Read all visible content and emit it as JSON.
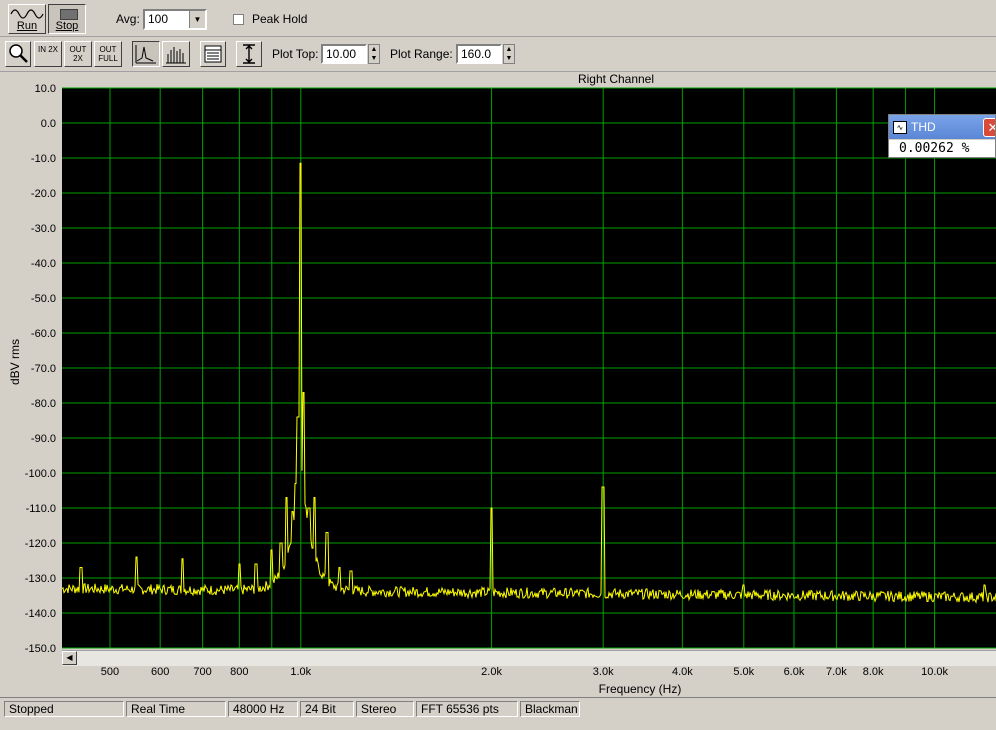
{
  "toolbar1": {
    "run_label": "Run",
    "stop_label": "Stop",
    "avg_label": "Avg:",
    "avg_value": "100",
    "peak_hold_label": "Peak Hold",
    "peak_hold_checked": false
  },
  "toolbar2": {
    "zoom_in_2x_label": "IN 2X",
    "zoom_out_2x_label": "OUT 2X",
    "zoom_out_full_label": "OUT FULL",
    "plot_top_label": "Plot Top:",
    "plot_top_value": "10.00",
    "plot_range_label": "Plot Range:",
    "plot_range_value": "160.0"
  },
  "thd": {
    "title": "THD",
    "value": "0.00262 %"
  },
  "colors": {
    "plot_background": "#000000",
    "grid": "#00a000",
    "trace": "#ffff00"
  },
  "chart_data": {
    "type": "line",
    "title": "Right Channel",
    "xlabel": "Frequency (Hz)",
    "ylabel": "dBV rms",
    "x_scale": "log",
    "xlim": [
      420,
      12500
    ],
    "ylim": [
      -150,
      10
    ],
    "y_ticks": [
      "10.0",
      "0.0",
      "-10.0",
      "-20.0",
      "-30.0",
      "-40.0",
      "-50.0",
      "-60.0",
      "-70.0",
      "-80.0",
      "-90.0",
      "-100.0",
      "-110.0",
      "-120.0",
      "-130.0",
      "-140.0",
      "-150.0"
    ],
    "x_tick_labels": [
      {
        "f": 500,
        "label": "500"
      },
      {
        "f": 600,
        "label": "600"
      },
      {
        "f": 700,
        "label": "700"
      },
      {
        "f": 800,
        "label": "800"
      },
      {
        "f": 1000,
        "label": "1.0k"
      },
      {
        "f": 2000,
        "label": "2.0k"
      },
      {
        "f": 3000,
        "label": "3.0k"
      },
      {
        "f": 4000,
        "label": "4.0k"
      },
      {
        "f": 5000,
        "label": "5.0k"
      },
      {
        "f": 6000,
        "label": "6.0k"
      },
      {
        "f": 7000,
        "label": "7.0k"
      },
      {
        "f": 8000,
        "label": "8.0k"
      },
      {
        "f": 10000,
        "label": "10.0k"
      }
    ],
    "grid": true,
    "noise_floor_db": -134.5,
    "series": [
      {
        "points": [
          {
            "f": 450,
            "db": -127
          },
          {
            "f": 550,
            "db": -124
          },
          {
            "f": 650,
            "db": -124.5
          },
          {
            "f": 800,
            "db": -126
          },
          {
            "f": 850,
            "db": -126
          },
          {
            "f": 900,
            "db": -122
          },
          {
            "f": 930,
            "db": -120
          },
          {
            "f": 950,
            "db": -107
          },
          {
            "f": 970,
            "db": -111
          },
          {
            "f": 980,
            "db": -103
          },
          {
            "f": 990,
            "db": -84
          },
          {
            "f": 1000,
            "db": -11.5
          },
          {
            "f": 1010,
            "db": -77
          },
          {
            "f": 1030,
            "db": -110
          },
          {
            "f": 1050,
            "db": -107
          },
          {
            "f": 1100,
            "db": -117
          },
          {
            "f": 1150,
            "db": -127
          },
          {
            "f": 1200,
            "db": -128
          },
          {
            "f": 2000,
            "db": -110
          },
          {
            "f": 3000,
            "db": -104
          },
          {
            "f": 5000,
            "db": -132
          },
          {
            "f": 12000,
            "db": -132
          }
        ]
      }
    ]
  },
  "status": {
    "state": "Stopped",
    "mode": "Real Time",
    "sample_rate": "48000 Hz",
    "bit_depth": "24 Bit",
    "channels": "Stereo",
    "fft_size": "FFT 65536 pts",
    "window": "Blackman"
  }
}
